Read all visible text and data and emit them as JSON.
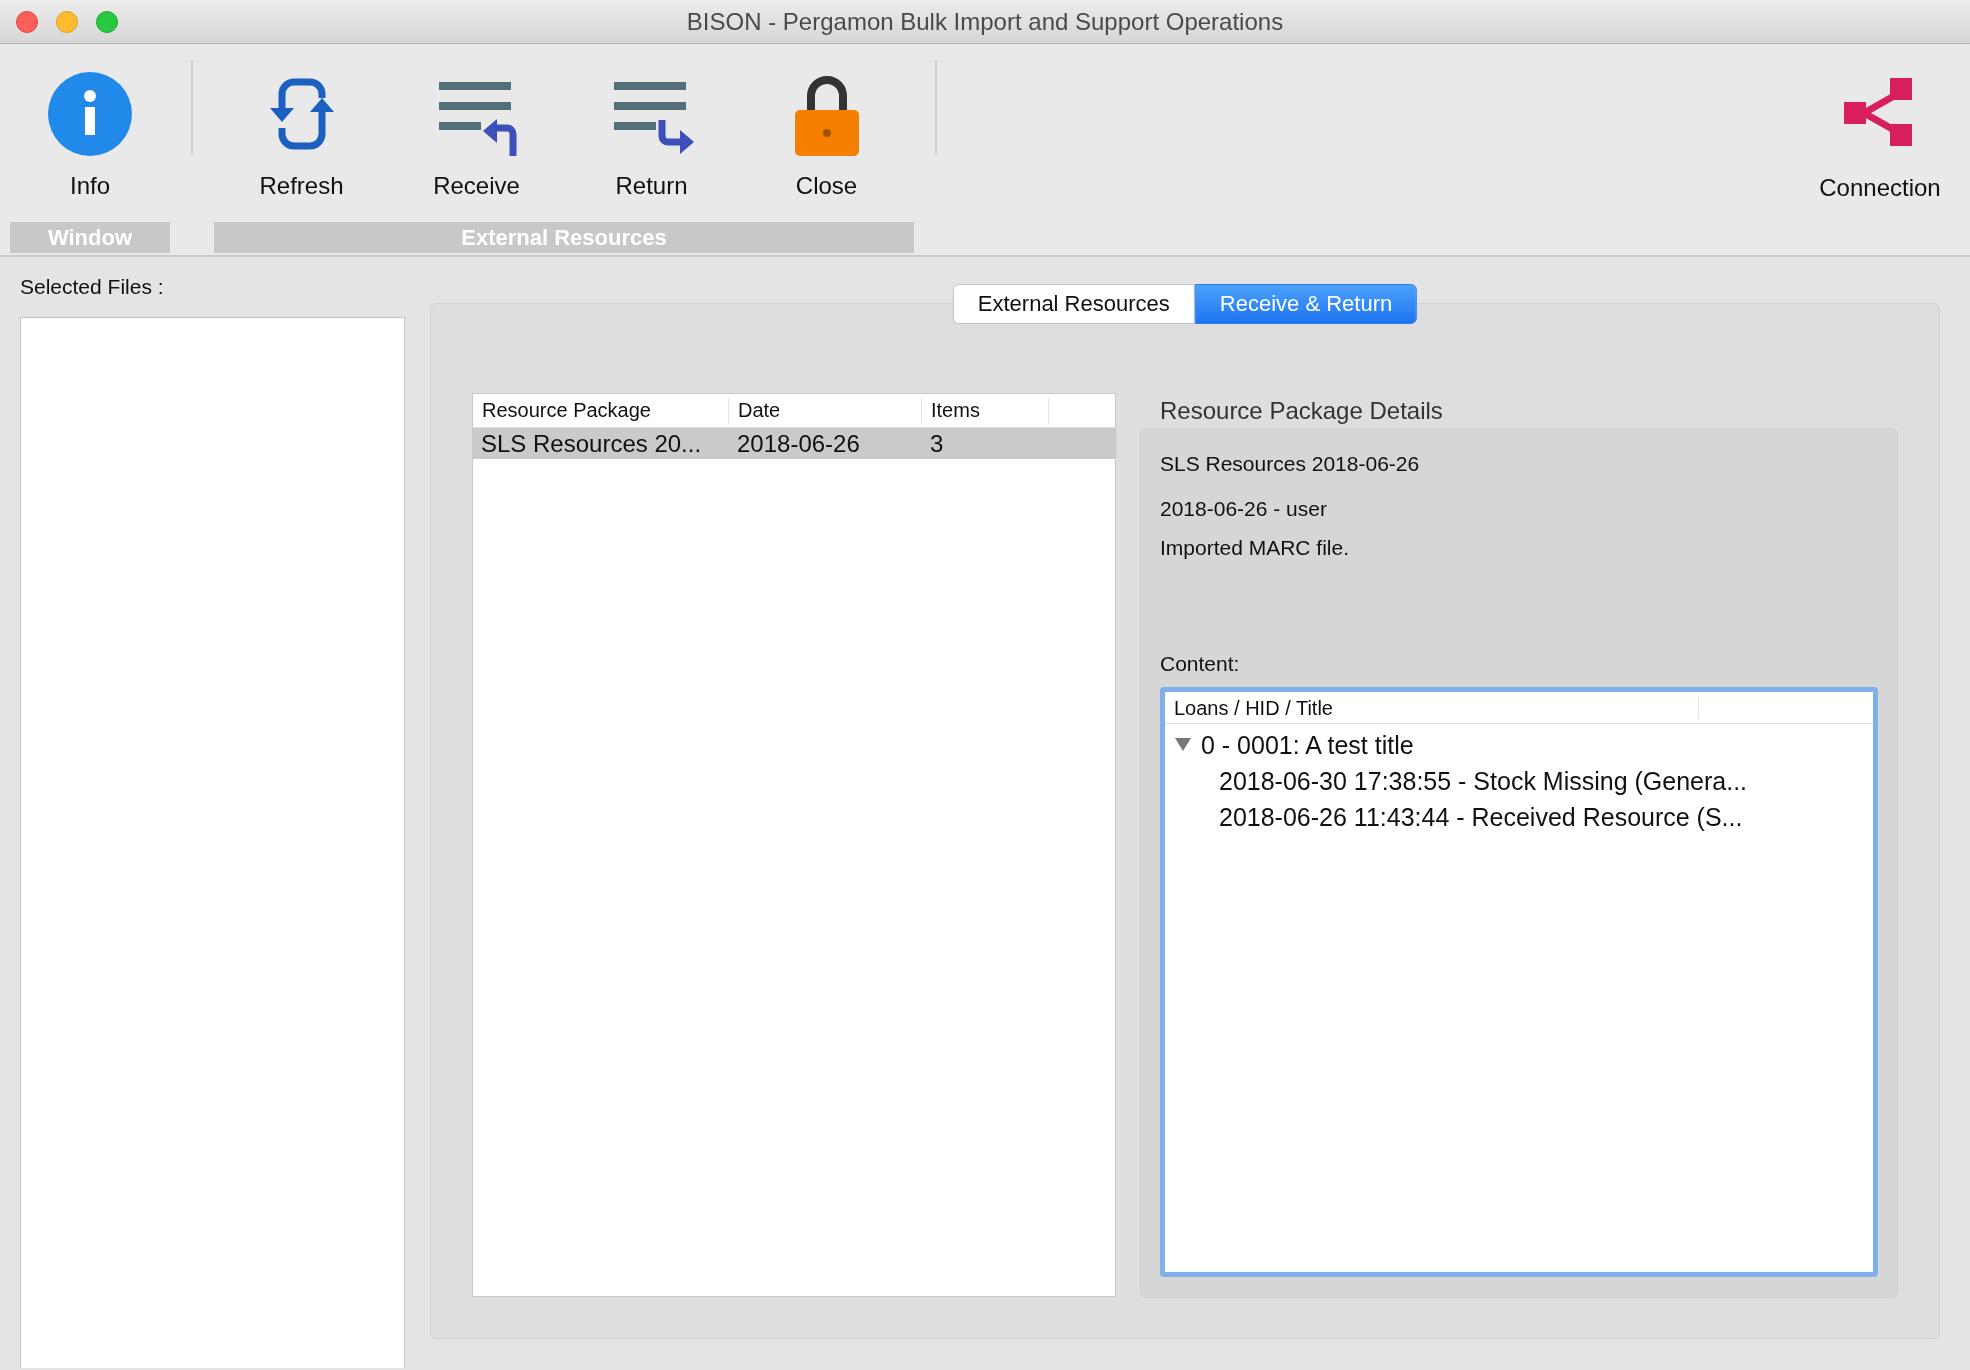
{
  "window": {
    "title": "BISON - Pergamon Bulk Import and Support Operations"
  },
  "toolbar": {
    "groups": [
      {
        "label": "Window",
        "items": [
          {
            "label": "Info",
            "kind": "info"
          }
        ]
      },
      {
        "label": "External Resources",
        "items": [
          {
            "label": "Refresh",
            "kind": "refresh"
          },
          {
            "label": "Receive",
            "kind": "receive"
          },
          {
            "label": "Return",
            "kind": "return"
          },
          {
            "label": "Close",
            "kind": "lock"
          }
        ]
      }
    ],
    "trailing": [
      {
        "label": "Connection",
        "kind": "connection"
      }
    ]
  },
  "sidebar": {
    "label": "Selected Files :"
  },
  "tabs": [
    {
      "label": "External Resources",
      "selected": false
    },
    {
      "label": "Receive & Return",
      "selected": true
    }
  ],
  "packages": {
    "columns": [
      "Resource Package",
      "Date",
      "Items"
    ],
    "rows": [
      {
        "cells": [
          "SLS Resources 20...",
          "2018-06-26",
          "3"
        ],
        "selected": true
      }
    ]
  },
  "details": {
    "title": "Resource Package Details",
    "lines": [
      "SLS Resources 2018-06-26",
      "2018-06-26 - user",
      "Imported MARC file."
    ],
    "content_label": "Content:",
    "tree": {
      "columns": [
        "Loans / HID / Title"
      ],
      "items": [
        {
          "label": "0 - 0001: A test title",
          "expanded": true,
          "children": [
            {
              "label": "2018-06-30 17:38:55 - Stock Missing (Genera..."
            },
            {
              "label": "2018-06-26 11:43:44 - Received Resource (S..."
            }
          ]
        }
      ]
    }
  }
}
